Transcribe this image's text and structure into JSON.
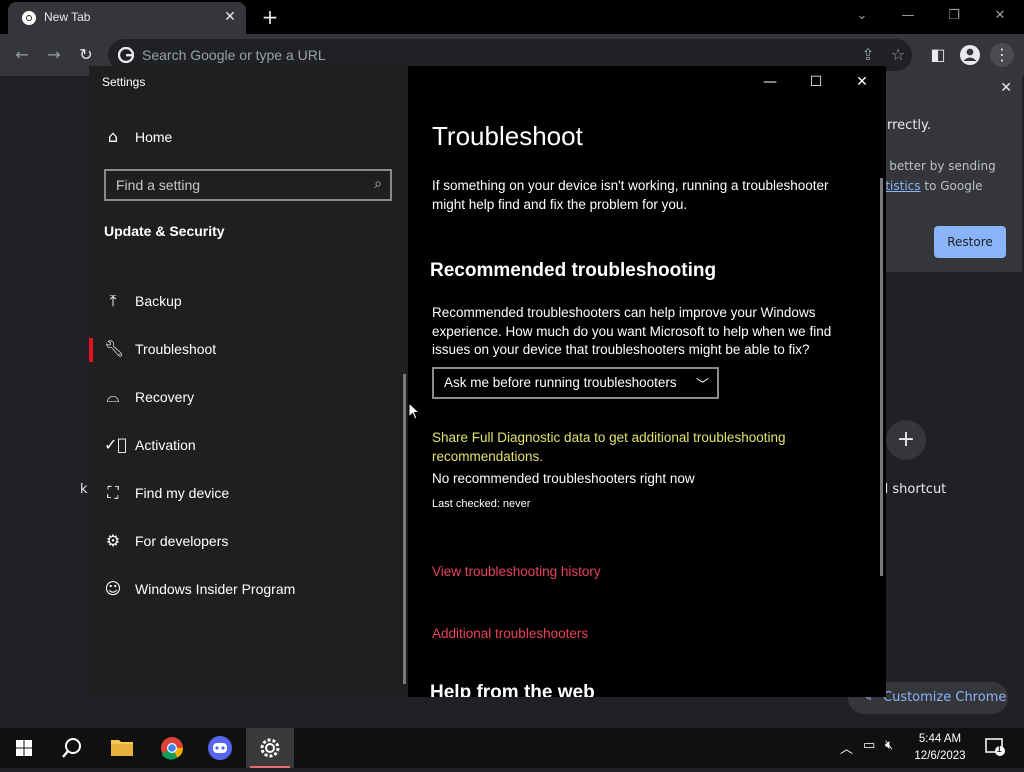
{
  "browser": {
    "tab_title": "New Tab",
    "omnibox_placeholder": "Search Google or type a URL",
    "promo": {
      "line1": "rrectly.",
      "line2": "e better by sending",
      "line3_link": "atistics",
      "line3_rest": " to Google",
      "restore_label": "Restore"
    },
    "add_shortcut_label": "d shortcut",
    "left_fragment": "k",
    "customize_label": "Customize Chrome"
  },
  "settings": {
    "app_title": "Settings",
    "home_label": "Home",
    "search_placeholder": "Find a setting",
    "section_title": "Update & Security",
    "nav_items": [
      {
        "label": "Backup",
        "icon": "backup-icon"
      },
      {
        "label": "Troubleshoot",
        "icon": "wrench-icon",
        "active": true
      },
      {
        "label": "Recovery",
        "icon": "recovery-icon"
      },
      {
        "label": "Activation",
        "icon": "activation-icon"
      },
      {
        "label": "Find my device",
        "icon": "find-device-icon"
      },
      {
        "label": "For developers",
        "icon": "developers-icon"
      },
      {
        "label": "Windows Insider Program",
        "icon": "insider-icon"
      }
    ],
    "page_title": "Troubleshoot",
    "intro": "If something on your device isn't working, running a troubleshooter might help find and fix the problem for you.",
    "recommended_heading": "Recommended troubleshooting",
    "recommended_desc": "Recommended troubleshooters can help improve your Windows experience. How much do you want Microsoft to help when we find issues on your device that troubleshooters might be able to fix?",
    "dropdown_value": "Ask me before running troubleshooters",
    "diagnostic_link": "Share Full Diagnostic data to get additional troubleshooting recommendations.",
    "no_recommended": "No recommended troubleshooters right now",
    "last_checked": "Last checked: never",
    "history_link": "View troubleshooting history",
    "additional_link": "Additional troubleshooters",
    "help_heading": "Help from the web"
  },
  "taskbar": {
    "time": "5:44 AM",
    "date": "12/6/2023",
    "notification_count": "1"
  },
  "colors": {
    "accent_red": "#e81123",
    "link_red": "#e8415b",
    "link_yellow": "#e3e36b",
    "chrome_blue": "#8ab4f8"
  }
}
